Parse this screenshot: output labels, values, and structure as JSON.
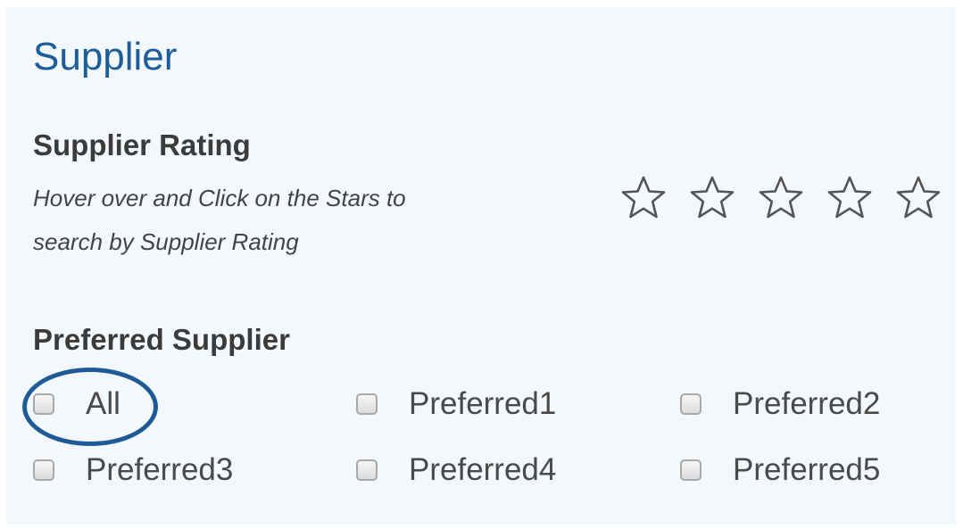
{
  "supplier": {
    "title": "Supplier",
    "rating": {
      "heading": "Supplier Rating",
      "hint_line1": "Hover over and Click on the Stars to",
      "hint_line2": "search by Supplier Rating",
      "max_stars": 5,
      "selected_stars": 0,
      "star_icon": "star-outline-icon"
    },
    "preferred": {
      "heading": "Preferred Supplier",
      "options": [
        {
          "label": "All",
          "checked": false
        },
        {
          "label": "Preferred1",
          "checked": false
        },
        {
          "label": "Preferred2",
          "checked": false
        },
        {
          "label": "Preferred3",
          "checked": false
        },
        {
          "label": "Preferred4",
          "checked": false
        },
        {
          "label": "Preferred5",
          "checked": false
        }
      ]
    }
  },
  "colors": {
    "panel_background": "#f3f8fc",
    "title_color": "#1d5e98",
    "heading_color": "#3b3b3b",
    "highlight_ring": "#1f5a97"
  }
}
